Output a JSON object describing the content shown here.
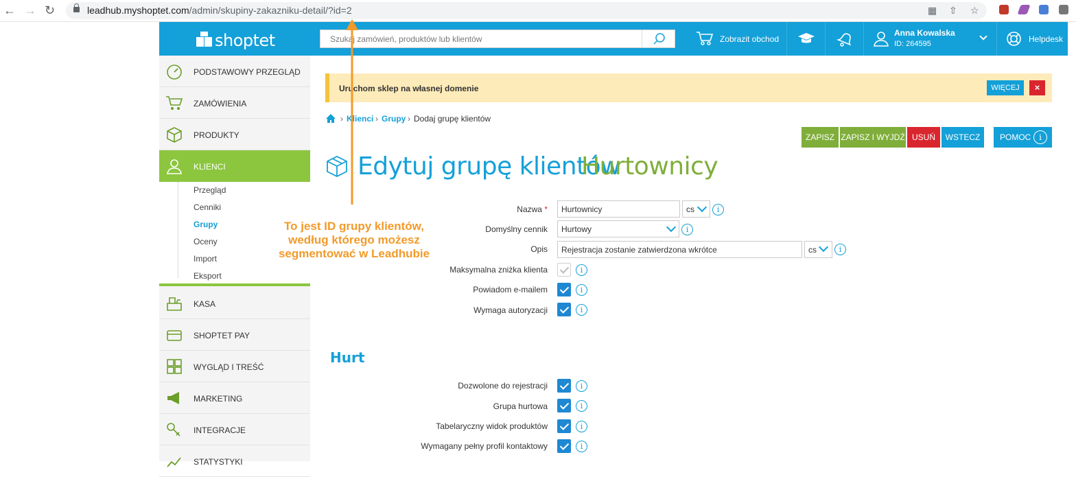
{
  "browser": {
    "url_host": "leadhub.myshoptet.com",
    "url_path": "/admin/skupiny-zakazniku-detail/?id=2"
  },
  "header": {
    "logo_text": "shoptet",
    "search_placeholder": "Szukaj zamówień, produktów lub klientów",
    "show_store_label": "Zobrazit obchod",
    "user_name": "Anna Kowalska",
    "user_id": "ID: 264595",
    "helpdesk_label": "Helpdesk"
  },
  "sidebar": {
    "items": [
      {
        "label": "PODSTAWOWY PRZEGLĄD",
        "icon": "speedometer-icon"
      },
      {
        "label": "ZAMÓWIENIA",
        "icon": "cart-icon"
      },
      {
        "label": "PRODUKTY",
        "icon": "box-icon"
      },
      {
        "label": "KLIENCI",
        "icon": "user-icon"
      },
      {
        "label": "KASA",
        "icon": "cash-register-icon"
      },
      {
        "label": "SHOPTET PAY",
        "icon": "wallet-icon"
      },
      {
        "label": "WYGLĄD I TREŚĆ",
        "icon": "layout-icon"
      },
      {
        "label": "MARKETING",
        "icon": "megaphone-icon"
      },
      {
        "label": "INTEGRACJE",
        "icon": "plug-icon"
      },
      {
        "label": "STATYSTYKI",
        "icon": "chart-icon"
      }
    ],
    "subitems": [
      "Przegląd",
      "Cenniki",
      "Grupy",
      "Oceny",
      "Import",
      "Eksport"
    ]
  },
  "banner": {
    "text": "Uruchom sklep na własnej domenie",
    "more_label": "WIĘCEJ",
    "close_label": "×"
  },
  "breadcrumb": {
    "klienci": "Klienci",
    "grupy": "Grupy",
    "current": "Dodaj grupę klientów"
  },
  "toolbar": {
    "save": "ZAPISZ",
    "save_exit": "ZAPISZ I WYJDŹ",
    "delete": "USUŃ",
    "back": "WSTECZ",
    "help": "POMOC"
  },
  "page": {
    "title": "Edytuj grupę klientów",
    "name": "Hurtownicy"
  },
  "form": {
    "name_label": "Nazwa",
    "required_mark": "*",
    "name_value": "Hurtownicy",
    "lang": "cs",
    "pricelist_label": "Domyślny cennik",
    "pricelist_value": "Hurtowy",
    "desc_label": "Opis",
    "desc_value": "Rejestracja zostanie zatwierdzona wkrótce",
    "max_discount_label": "Maksymalna zniżka klienta",
    "notify_label": "Powiadom e-mailem",
    "auth_label": "Wymaga autoryzacji"
  },
  "wholesale": {
    "title": "Hurt",
    "allowed_reg_label": "Dozwolone do rejestracji",
    "group_label": "Grupa hurtowa",
    "table_view_label": "Tabelaryczny widok produktów",
    "full_profile_label": "Wymagany pełny profil kontaktowy"
  },
  "annotation": {
    "line1": "To jest ID grupy klientów,",
    "line2": "według którego możesz",
    "line3": "segmentować w Leadhubie"
  },
  "colors": {
    "primary": "#14a0d8",
    "green": "#8cc63f",
    "red": "#d9262e",
    "orange": "#f29a29"
  }
}
